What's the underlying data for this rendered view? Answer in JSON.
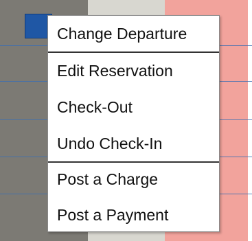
{
  "menu": {
    "items": [
      {
        "label": "Change Departure"
      },
      {
        "label": "Edit Reservation"
      },
      {
        "label": "Check-Out"
      },
      {
        "label": "Undo Check-In"
      },
      {
        "label": "Post a Charge"
      },
      {
        "label": "Post a Payment"
      }
    ]
  }
}
